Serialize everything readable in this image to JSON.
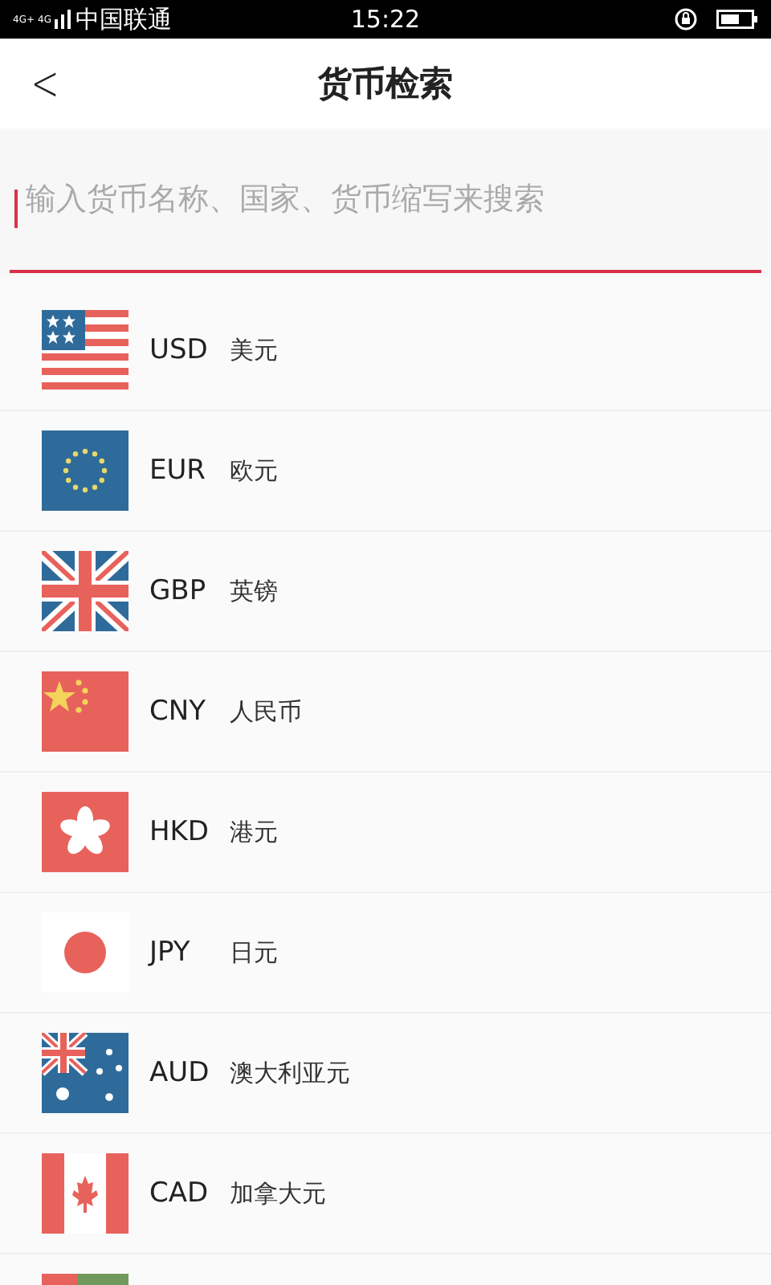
{
  "status_bar": {
    "network_1": "4G+",
    "network_2": "4G",
    "carrier": "中国联通",
    "time": "15:22"
  },
  "header": {
    "back": "<",
    "title": "货币检索"
  },
  "search": {
    "placeholder": "输入货币名称、国家、货币缩写来搜索"
  },
  "currencies": [
    {
      "code": "USD",
      "name": "美元",
      "kind": "us"
    },
    {
      "code": "EUR",
      "name": "欧元",
      "kind": "eu"
    },
    {
      "code": "GBP",
      "name": "英镑",
      "kind": "gb"
    },
    {
      "code": "CNY",
      "name": "人民币",
      "kind": "cn"
    },
    {
      "code": "HKD",
      "name": "港元",
      "kind": "hk"
    },
    {
      "code": "JPY",
      "name": "日元",
      "kind": "jp"
    },
    {
      "code": "AUD",
      "name": "澳大利亚元",
      "kind": "au"
    },
    {
      "code": "CAD",
      "name": "加拿大元",
      "kind": "ca"
    },
    {
      "kind": "rg"
    }
  ]
}
